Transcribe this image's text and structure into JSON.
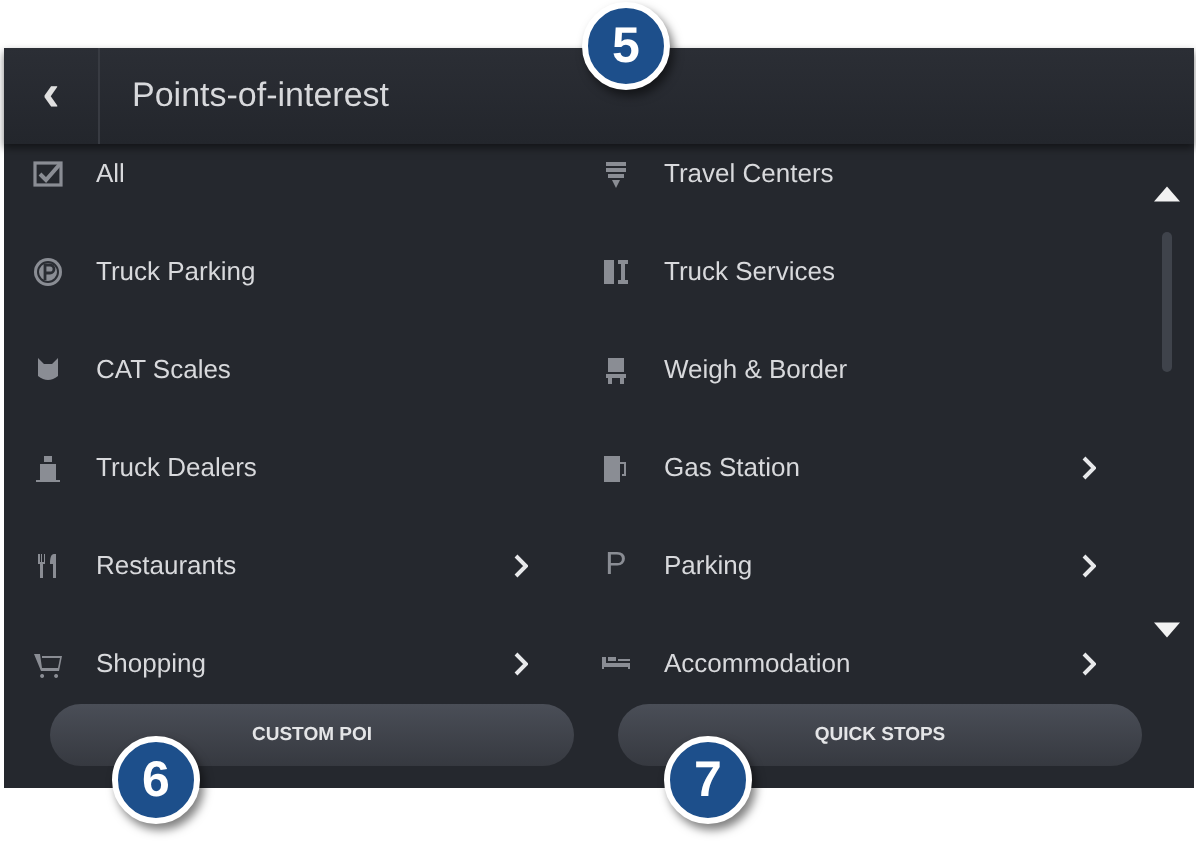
{
  "header": {
    "back": "‹",
    "title": "Points-of-interest"
  },
  "columns": [
    [
      {
        "kind": "checkbox",
        "label": "All",
        "checked": true,
        "submenu": false
      },
      {
        "kind": "category",
        "label": "Truck Parking",
        "submenu": false
      },
      {
        "kind": "category",
        "label": "CAT Scales",
        "submenu": false
      },
      {
        "kind": "category",
        "label": "Truck Dealers",
        "submenu": false
      },
      {
        "kind": "category",
        "label": "Restaurants",
        "submenu": true
      },
      {
        "kind": "category",
        "label": "Shopping",
        "submenu": true
      }
    ],
    [
      {
        "kind": "category",
        "label": "Travel Centers",
        "submenu": false
      },
      {
        "kind": "category",
        "label": "Truck Services",
        "submenu": false
      },
      {
        "kind": "category",
        "label": "Weigh & Border",
        "submenu": false
      },
      {
        "kind": "category",
        "label": "Gas Station",
        "submenu": true
      },
      {
        "kind": "category",
        "label": "Parking",
        "glyph": "P",
        "submenu": true
      },
      {
        "kind": "category",
        "label": "Accommodation",
        "submenu": true
      }
    ]
  ],
  "buttons": [
    "CUSTOM POI",
    "QUICK STOPS"
  ],
  "callouts": [
    "5",
    "6",
    "7"
  ]
}
